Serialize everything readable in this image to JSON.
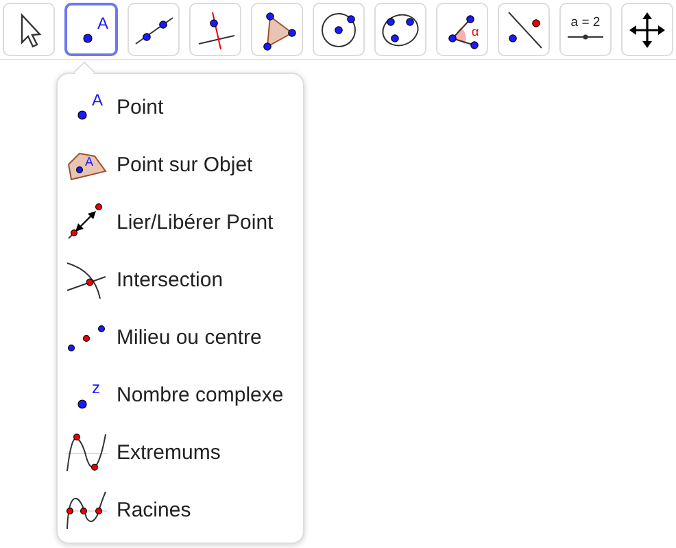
{
  "toolbar": [
    {
      "kind": "move",
      "selected": false
    },
    {
      "kind": "point",
      "glyph": "A",
      "selected": true
    },
    {
      "kind": "line",
      "selected": false
    },
    {
      "kind": "perpendicular",
      "selected": false
    },
    {
      "kind": "polygon",
      "selected": false
    },
    {
      "kind": "circle",
      "selected": false
    },
    {
      "kind": "conic",
      "selected": false
    },
    {
      "kind": "angle",
      "glyph": "α",
      "selected": false
    },
    {
      "kind": "reflect",
      "selected": false
    },
    {
      "kind": "slider",
      "glyph": "a = 2",
      "selected": false
    },
    {
      "kind": "move-view",
      "selected": false
    }
  ],
  "menu": [
    {
      "kind": "point",
      "glyph": "A",
      "label": "Point"
    },
    {
      "kind": "point-on-object",
      "glyph": "A",
      "label": "Point sur Objet"
    },
    {
      "kind": "attach",
      "label": "Lier/Libérer Point"
    },
    {
      "kind": "intersect",
      "label": "Intersection"
    },
    {
      "kind": "midpoint",
      "label": "Milieu ou centre"
    },
    {
      "kind": "complex",
      "glyph": "z",
      "label": "Nombre complexe"
    },
    {
      "kind": "extremum",
      "label": "Extremums"
    },
    {
      "kind": "roots",
      "label": "Racines"
    }
  ]
}
